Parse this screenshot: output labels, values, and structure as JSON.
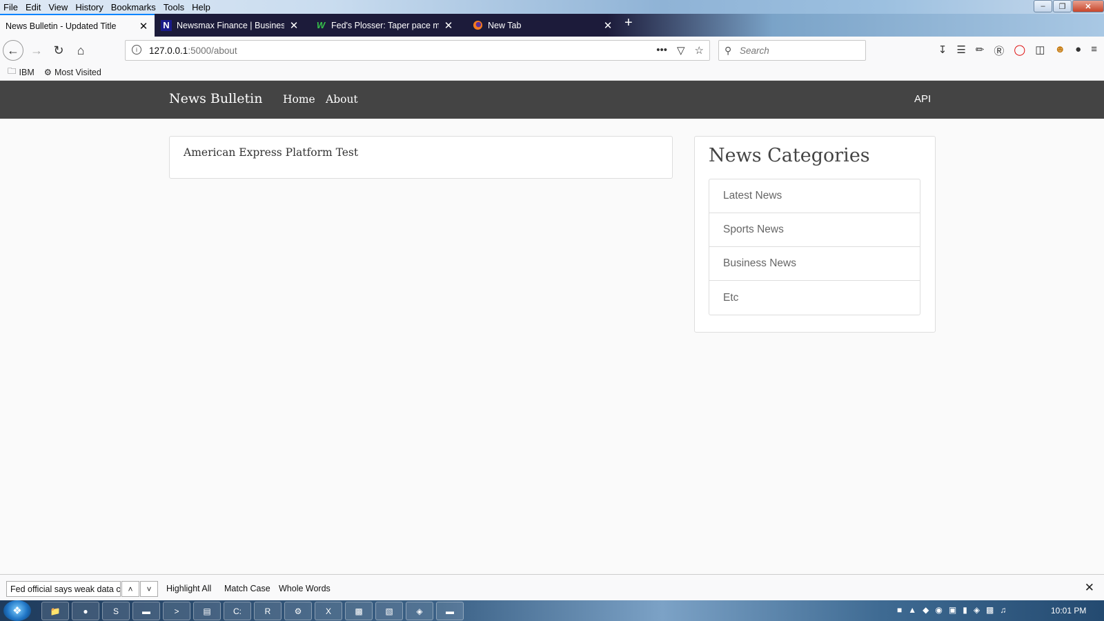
{
  "window": {
    "title": "News Bulletin - Updated Title",
    "menu": [
      "File",
      "Edit",
      "View",
      "History",
      "Bookmarks",
      "Tools",
      "Help"
    ]
  },
  "tabs": [
    {
      "label": "News Bulletin - Updated Title",
      "active": true
    },
    {
      "label": "Newsmax Finance | Business News",
      "favicon": "N"
    },
    {
      "label": "Fed's Plosser: Taper pace may be",
      "favicon": "W"
    },
    {
      "label": "New Tab"
    }
  ],
  "address": {
    "host": "127.0.0.1",
    "path": ":5000/about"
  },
  "search": {
    "placeholder": "Search"
  },
  "bookmarks": [
    "IBM",
    "Most Visited"
  ],
  "site": {
    "brand": "News Bulletin",
    "nav": [
      "Home",
      "About"
    ],
    "right_link": "API"
  },
  "post": {
    "title": "American Express Platform Test"
  },
  "sidebar": {
    "title": "News Categories",
    "items": [
      "Latest News",
      "Sports News",
      "Business News",
      "Etc"
    ]
  },
  "findbar": {
    "query": "Fed official says weak data ca",
    "options": [
      "Highlight All",
      "Match Case",
      "Whole Words"
    ]
  },
  "taskbar": {
    "clock": "10:01 PM"
  },
  "colors": {
    "site_nav": "#444444",
    "tab_accent": "#0a84ff"
  }
}
